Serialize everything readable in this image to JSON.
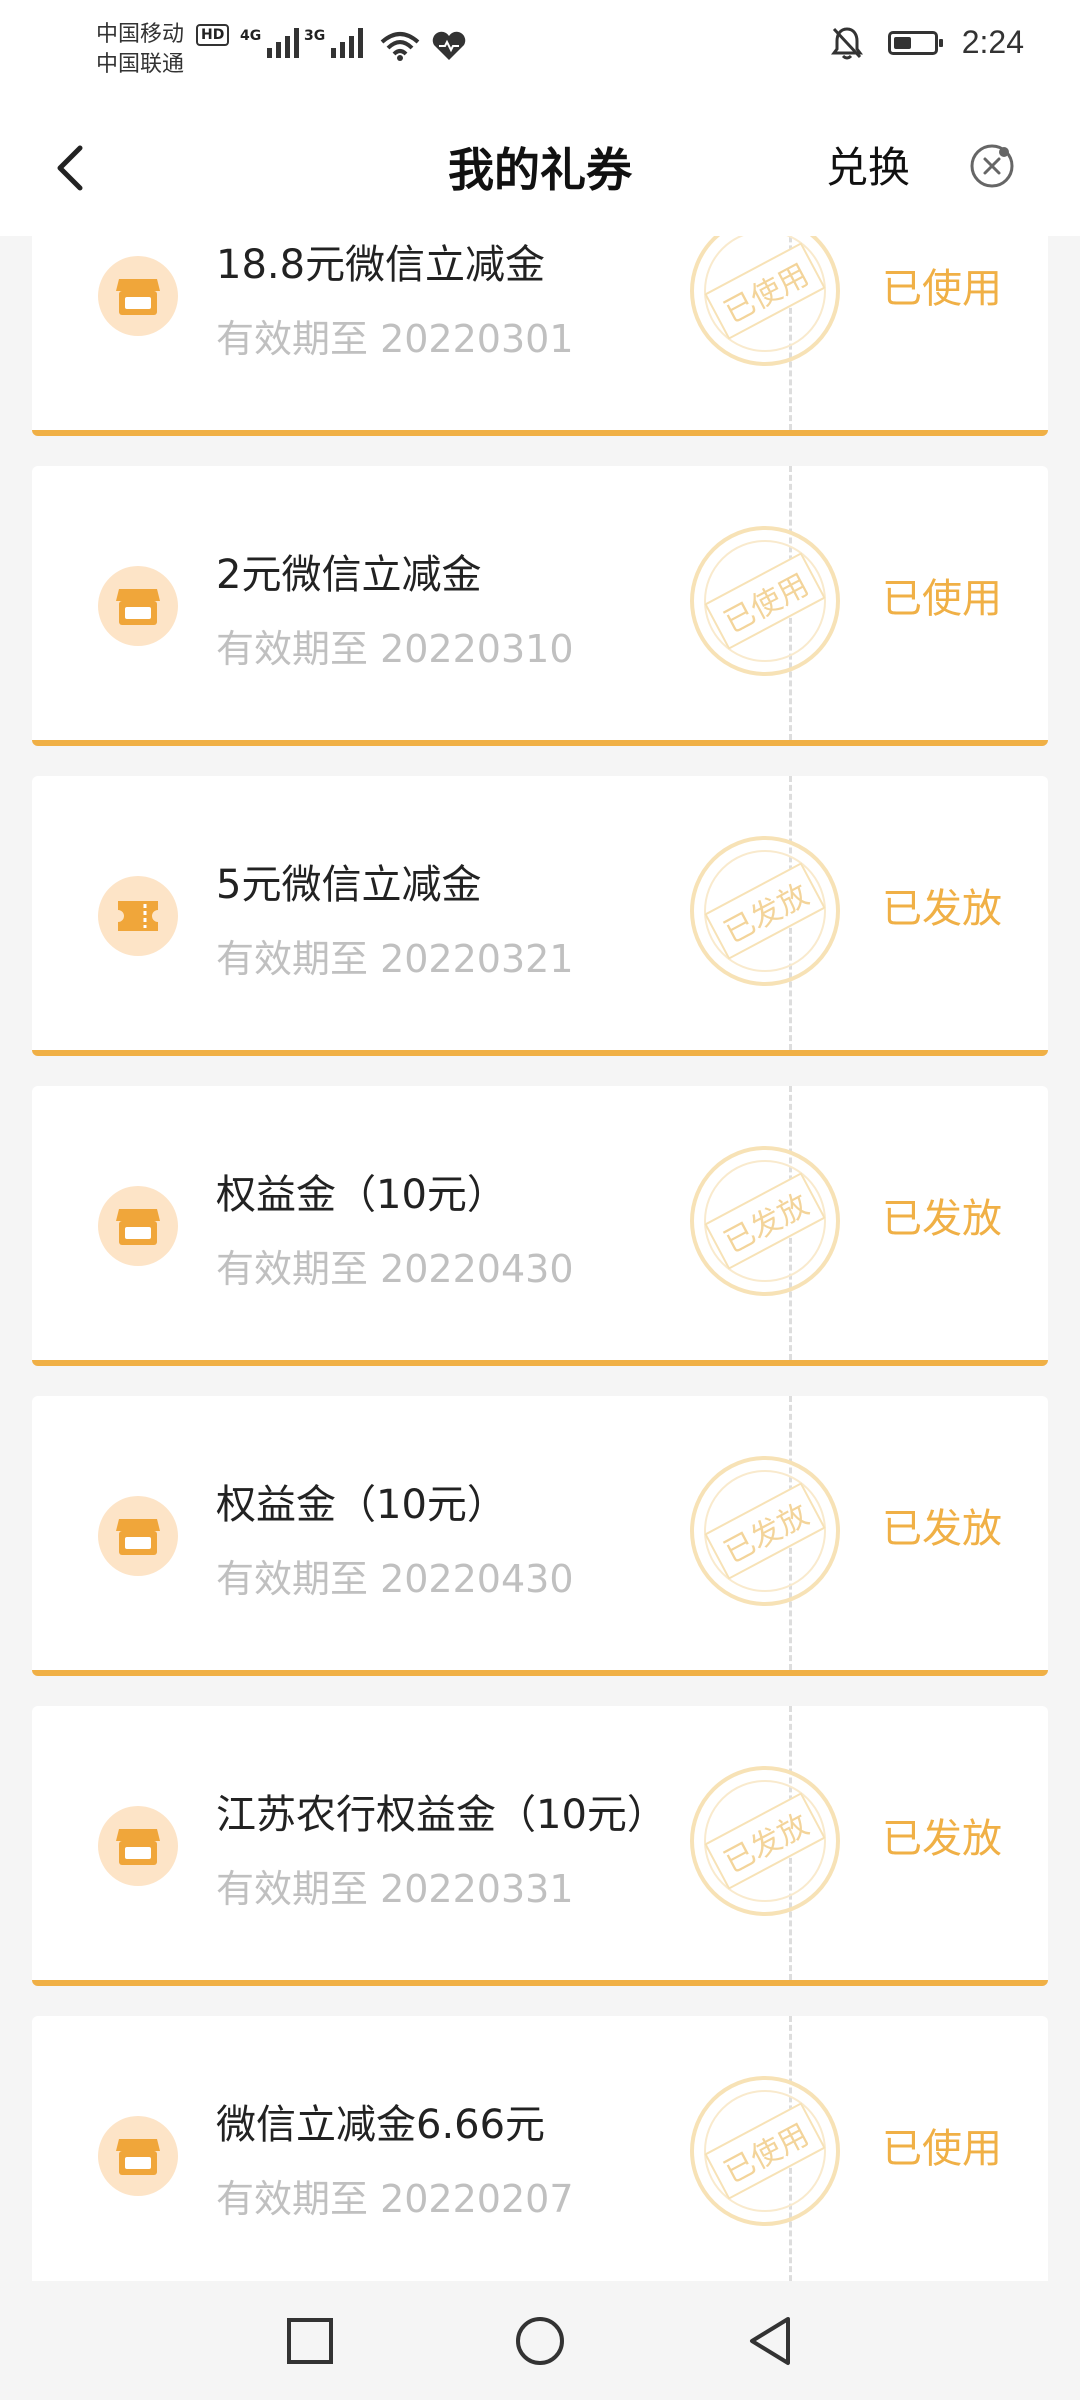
{
  "status_bar": {
    "carrier1": "中国移动",
    "carrier2": "中国联通",
    "hd_badge": "HD",
    "net1": "4G",
    "net2": "3G",
    "time": "2:24",
    "battery_level": 0.45
  },
  "header": {
    "title": "我的礼券",
    "exchange_label": "兑换"
  },
  "coupons": [
    {
      "name": "18.8元微信立减金",
      "expiry": "有效期至 20220301",
      "stamp": "已使用",
      "state": "已使用",
      "icon": "store-icon"
    },
    {
      "name": "2元微信立减金",
      "expiry": "有效期至 20220310",
      "stamp": "已使用",
      "state": "已使用",
      "icon": "store-icon"
    },
    {
      "name": "5元微信立减金",
      "expiry": "有效期至 20220321",
      "stamp": "已发放",
      "state": "已发放",
      "icon": "ticket-icon"
    },
    {
      "name": "权益金（10元）",
      "expiry": "有效期至 20220430",
      "stamp": "已发放",
      "state": "已发放",
      "icon": "store-icon"
    },
    {
      "name": "权益金（10元）",
      "expiry": "有效期至 20220430",
      "stamp": "已发放",
      "state": "已发放",
      "icon": "store-icon"
    },
    {
      "name": "江苏农行权益金（10元）",
      "expiry": "有效期至 20220331",
      "stamp": "已发放",
      "state": "已发放",
      "icon": "store-icon"
    },
    {
      "name": "微信立减金6.66元",
      "expiry": "有效期至 20220207",
      "stamp": "已使用",
      "state": "已使用",
      "icon": "store-icon"
    }
  ],
  "colors": {
    "accent": "#f0b046",
    "icon_bg": "#fde4c7",
    "muted_text": "#c0c0c0"
  }
}
